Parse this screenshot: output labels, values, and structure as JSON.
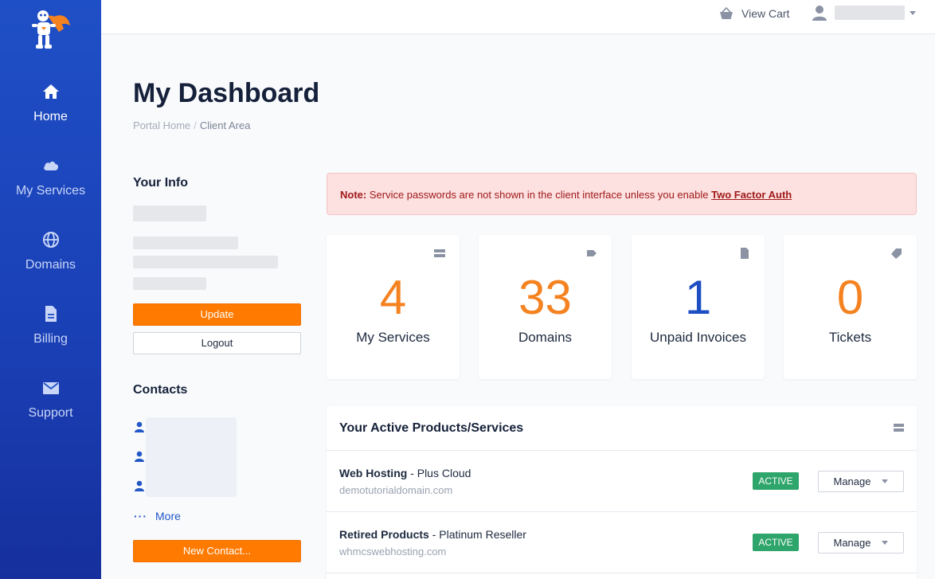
{
  "sidebar": {
    "items": [
      {
        "label": "Home",
        "icon": "home-icon",
        "active": true
      },
      {
        "label": "My Services",
        "icon": "cloud-icon"
      },
      {
        "label": "Domains",
        "icon": "globe-icon"
      },
      {
        "label": "Billing",
        "icon": "document-icon"
      },
      {
        "label": "Support",
        "icon": "envelope-icon"
      }
    ]
  },
  "topbar": {
    "view_cart": "View Cart"
  },
  "header": {
    "title": "My Dashboard",
    "breadcrumb": [
      "Portal Home",
      "Client Area"
    ]
  },
  "your_info": {
    "heading": "Your Info",
    "update_label": "Update",
    "logout_label": "Logout"
  },
  "contacts": {
    "heading": "Contacts",
    "more_label": "More",
    "new_contact_label": "New Contact..."
  },
  "alert": {
    "prefix": "Note:",
    "message": "Service passwords are not shown in the client interface unless you enable",
    "link": "Two Factor Auth"
  },
  "stats": [
    {
      "value": "4",
      "label": "My Services",
      "icon": "server-icon",
      "color": "#f58220"
    },
    {
      "value": "33",
      "label": "Domains",
      "icon": "tag-icon",
      "color": "#f58220"
    },
    {
      "value": "1",
      "label": "Unpaid Invoices",
      "icon": "file-icon",
      "color": "#1e4fc2"
    },
    {
      "value": "0",
      "label": "Tickets",
      "icon": "ticket-icon",
      "color": "#f58220"
    }
  ],
  "products": {
    "title": "Your Active Products/Services",
    "rows": [
      {
        "group": "Web Hosting",
        "name": " - Plus Cloud",
        "domain": "demotutorialdomain.com",
        "status": "ACTIVE",
        "action": "Manage"
      },
      {
        "group": "Retired Products",
        "name": " - Platinum Reseller",
        "domain": "whmcswebhosting.com",
        "status": "ACTIVE",
        "action": "Manage"
      }
    ]
  },
  "colors": {
    "sidebar": "#1f4fc6",
    "accent_orange": "#ff7a00",
    "active_badge": "#2ea56a",
    "alert_bg": "#fde0e0"
  }
}
